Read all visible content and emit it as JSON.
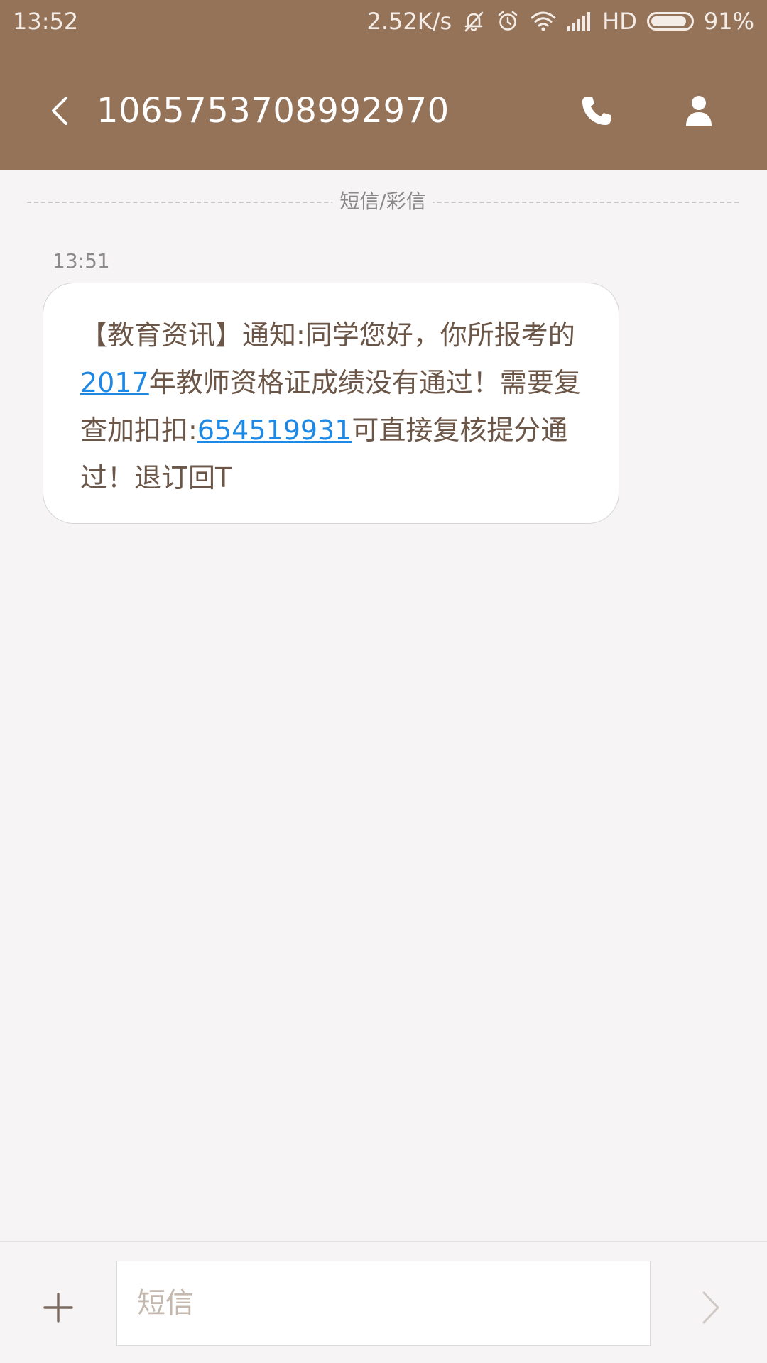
{
  "status_bar": {
    "time": "13:52",
    "network_speed": "2.52K/s",
    "hd_label": "HD",
    "battery_percent": "91%",
    "battery_level": 0.91,
    "icons": [
      "mute-icon",
      "alarm-icon",
      "wifi-icon",
      "signal-icon",
      "battery-icon"
    ]
  },
  "header": {
    "title": "1065753708992970",
    "background_color": "#957359",
    "back_icon": "chevron-left-icon",
    "call_icon": "phone-icon",
    "profile_icon": "person-icon"
  },
  "thread": {
    "divider_label": "短信/彩信",
    "messages": [
      {
        "time": "13:51",
        "segments": [
          {
            "text": "【教育资讯】通知:同学您好，你所报考的",
            "link": false
          },
          {
            "text": "2017",
            "link": true
          },
          {
            "text": "年教师资格证成绩没有通过！需要复查加扣扣:",
            "link": false
          },
          {
            "text": "654519931",
            "link": true
          },
          {
            "text": "可直接复核提分通过！退订回T",
            "link": false
          }
        ]
      }
    ]
  },
  "composer": {
    "placeholder": "短信",
    "add_icon": "plus-icon",
    "send_icon": "chevron-right-icon"
  },
  "colors": {
    "accent": "#957359",
    "link": "#1e88e5",
    "message_text": "#6b5647",
    "background": "#f6f4f5"
  }
}
